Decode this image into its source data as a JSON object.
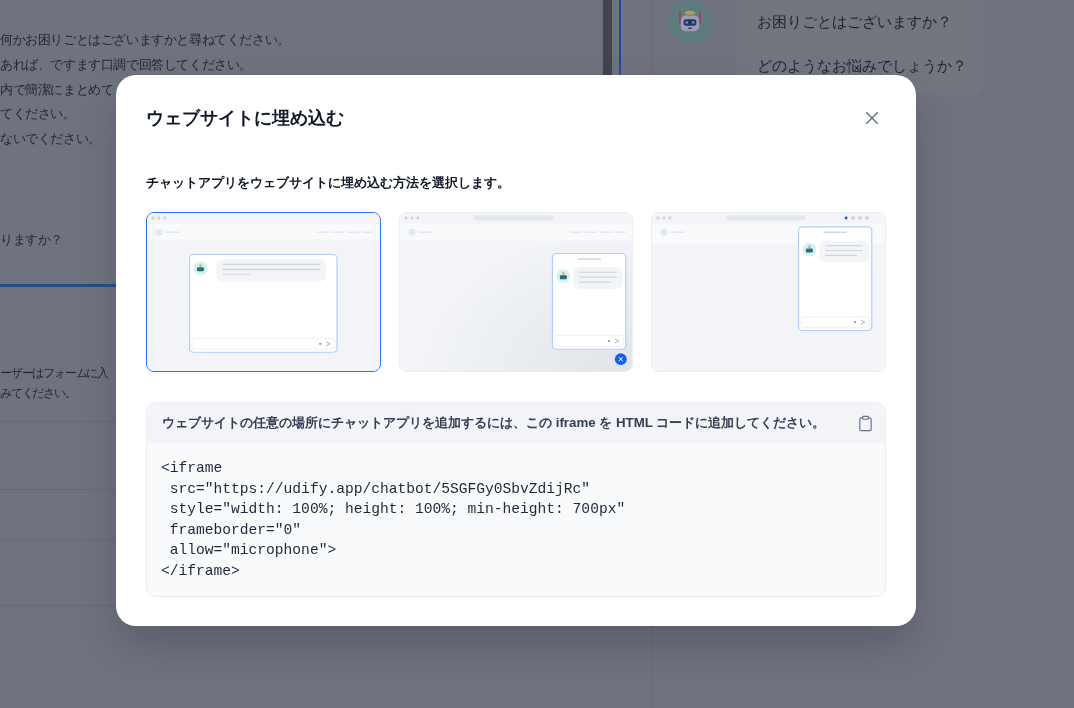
{
  "background": {
    "prompt_lines": [
      "何かお困りごとはございますかと尋ねてください。",
      "あれば、ですます口調で回答してください。",
      "内で簡潔にまとめて",
      "てください。",
      "ないでください。"
    ],
    "question_line": "りますか？",
    "form_note_lines": [
      "ーザーはフォームに入",
      "みてください。"
    ],
    "chat_bubble": {
      "lines": [
        "お困りごとはございますか？",
        "どのようなお悩みでしょうか？"
      ]
    }
  },
  "dialog": {
    "title": "ウェブサイトに埋め込む",
    "subtitle": "チャットアプリをウェブサイトに埋め込む方法を選択します。",
    "options": [
      {
        "kind": "centered",
        "selected": true
      },
      {
        "kind": "floating",
        "selected": false
      },
      {
        "kind": "side",
        "selected": false
      }
    ],
    "code_panel": {
      "instruction": "ウェブサイトの任意の場所にチャットアプリを追加するには、この iframe を HTML コードに追加してください。",
      "code_lines": [
        "<iframe",
        " src=\"https://udify.app/chatbot/5SGFGy0SbvZdijRc\"",
        " style=\"width: 100%; height: 100%; min-height: 700px\"",
        " frameborder=\"0\"",
        " allow=\"microphone\">",
        "</iframe>"
      ]
    }
  }
}
